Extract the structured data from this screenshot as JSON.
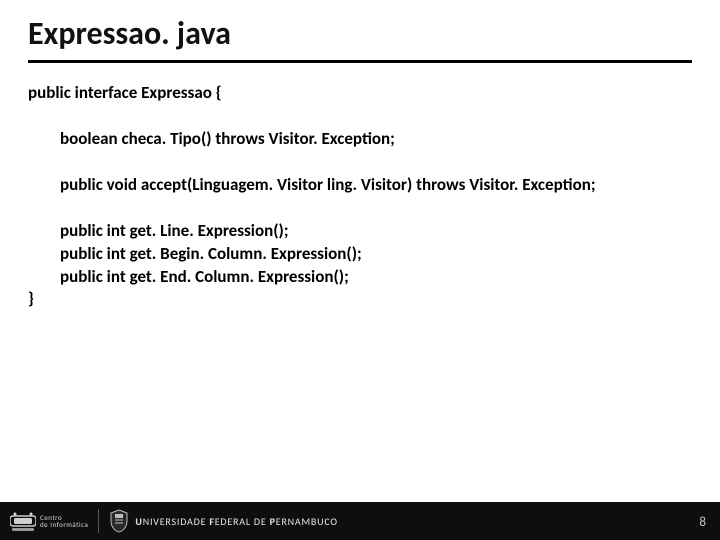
{
  "title": "Expressao. java",
  "code": {
    "open": "public interface Expressao {",
    "line_checatipo_prefix": "boolean ",
    "line_checatipo_name": "checa. Tipo",
    "line_checatipo_suffix": "() throws Visitor. Exception;",
    "line_accept_prefix": "public void ",
    "line_accept_name": "accept",
    "line_accept_params": "(Linguagem. Visitor ling. Visitor) ",
    "line_accept_throws": "throws Visitor. Exception;",
    "line_getline_prefix": "public int ",
    "line_getline_name": "get. Line. Expression",
    "line_getline_suffix": "();",
    "line_getbegin_prefix": "public int ",
    "line_getbegin_name": "get. Begin. Column. Expression",
    "line_getbegin_suffix": "();",
    "line_getend_prefix": "public int ",
    "line_getend_name": "get. End. Column. Expression",
    "line_getend_suffix": "();",
    "close": "}"
  },
  "footer": {
    "cin_line1": "Centro",
    "cin_line2": "de Informática",
    "ufpe_part1": "U",
    "ufpe_part2": "NIVERSIDADE ",
    "ufpe_part3": "F",
    "ufpe_part4": "EDERAL DE ",
    "ufpe_part5": "P",
    "ufpe_part6": "ERNAMBUCO",
    "page": "8"
  }
}
